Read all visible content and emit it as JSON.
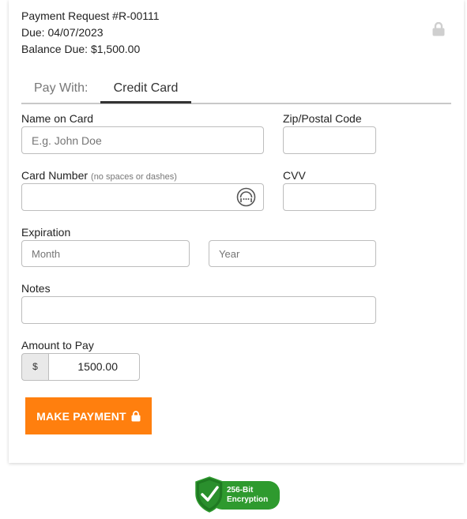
{
  "header": {
    "request": "Payment Request #R-00111",
    "due": "Due: 04/07/2023",
    "balance": "Balance Due: $1,500.00"
  },
  "tabs": {
    "pay_with": "Pay With:",
    "credit_card": "Credit Card"
  },
  "form": {
    "name_label": "Name on Card",
    "name_placeholder": "E.g. John Doe",
    "zip_label": "Zip/Postal Code",
    "card_label": "Card Number",
    "card_hint": "(no spaces or dashes)",
    "cvv_label": "CVV",
    "expiration_label": "Expiration",
    "month_placeholder": "Month",
    "year_placeholder": "Year",
    "notes_label": "Notes",
    "amount_label": "Amount to Pay",
    "currency": "$",
    "amount_value": "1500.00"
  },
  "button": {
    "label": "MAKE PAYMENT"
  },
  "badge": {
    "line1": "256-Bit",
    "line2": "Encryption"
  },
  "colors": {
    "accent": "#ff7f0e",
    "badge_green": "#2e9a2e"
  },
  "icons": [
    "lock-icon",
    "card-scan-icon",
    "shield-check-icon"
  ]
}
